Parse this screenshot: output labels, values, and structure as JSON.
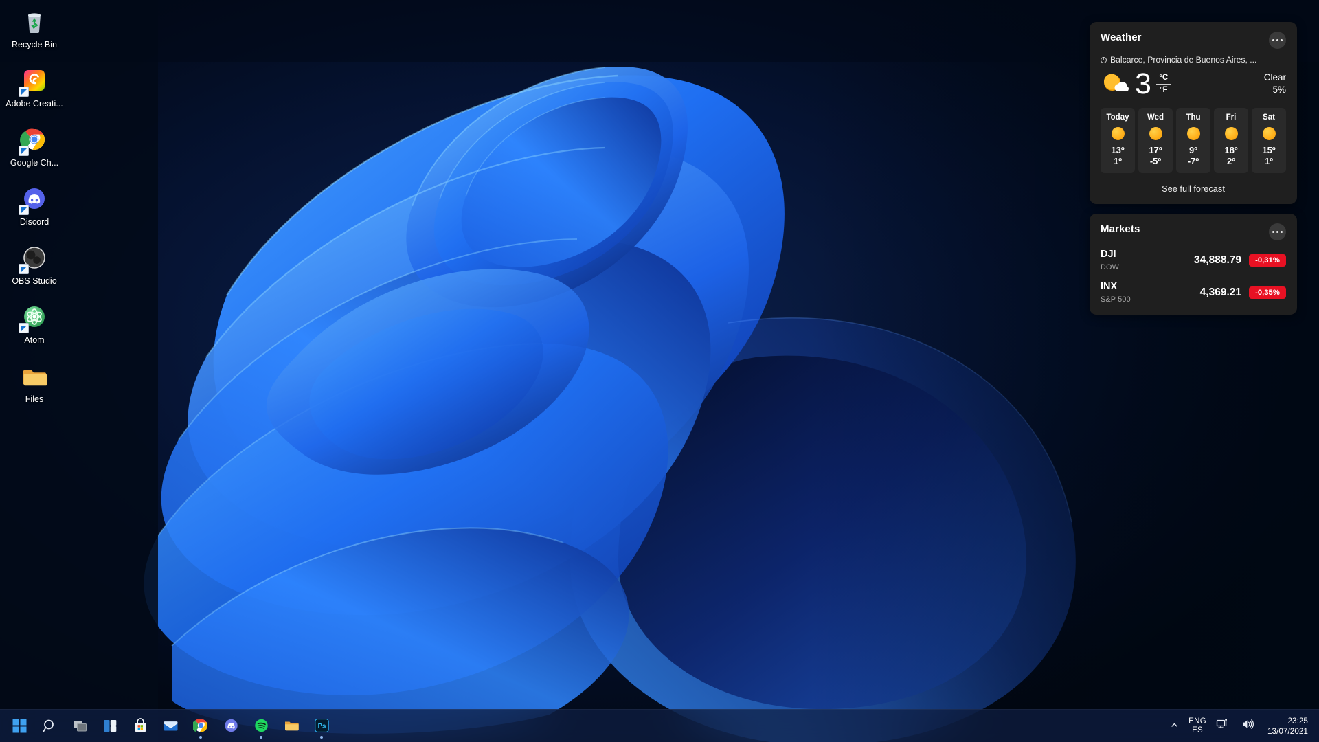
{
  "desktop": {
    "icons": [
      {
        "label": "Recycle Bin",
        "icon": "recycle-bin-icon",
        "shortcut": false
      },
      {
        "label": "Adobe Creati...",
        "icon": "adobe-creative-cloud-icon",
        "shortcut": true
      },
      {
        "label": "Google Ch...",
        "icon": "google-chrome-icon",
        "shortcut": true
      },
      {
        "label": "Discord",
        "icon": "discord-icon",
        "shortcut": true
      },
      {
        "label": "OBS Studio",
        "icon": "obs-studio-icon",
        "shortcut": true
      },
      {
        "label": "Atom",
        "icon": "atom-icon",
        "shortcut": true
      },
      {
        "label": "Files",
        "icon": "folder-icon",
        "shortcut": false
      }
    ]
  },
  "widgets": {
    "weather": {
      "title": "Weather",
      "more_label": "More options",
      "location": "Balcarce, Provincia de Buenos Aires, ...",
      "temperature": "3",
      "unit_primary": "ºC",
      "unit_secondary": "ºF",
      "condition": "Clear",
      "precipitation": "5%",
      "current_icon": "sun-behind-cloud-icon",
      "forecast": [
        {
          "day": "Today",
          "icon": "sunny-icon",
          "high": "13º",
          "low": "1º"
        },
        {
          "day": "Wed",
          "icon": "sunny-icon",
          "high": "17º",
          "low": "-5º"
        },
        {
          "day": "Thu",
          "icon": "sunny-icon",
          "high": "9º",
          "low": "-7º"
        },
        {
          "day": "Fri",
          "icon": "sunny-icon",
          "high": "18º",
          "low": "2º"
        },
        {
          "day": "Sat",
          "icon": "sunny-icon",
          "high": "15º",
          "low": "1º"
        }
      ],
      "see_full_forecast": "See full forecast"
    },
    "markets": {
      "title": "Markets",
      "more_label": "More options",
      "rows": [
        {
          "symbol": "DJI",
          "name": "DOW",
          "value": "34,888.79",
          "change": "-0,31%",
          "change_color": "#e81123"
        },
        {
          "symbol": "INX",
          "name": "S&P 500",
          "value": "4,369.21",
          "change": "-0,35%",
          "change_color": "#e81123"
        }
      ]
    }
  },
  "taskbar": {
    "items": [
      {
        "name": "start-button",
        "label": "Start"
      },
      {
        "name": "search-button",
        "label": "Search"
      },
      {
        "name": "task-view-button",
        "label": "Task View"
      },
      {
        "name": "widgets-button",
        "label": "Widgets"
      },
      {
        "name": "microsoft-store-button",
        "label": "Microsoft Store"
      },
      {
        "name": "mail-button",
        "label": "Mail"
      },
      {
        "name": "google-chrome-button",
        "label": "Google Chrome"
      },
      {
        "name": "discord-button",
        "label": "Discord"
      },
      {
        "name": "spotify-button",
        "label": "Spotify"
      },
      {
        "name": "file-explorer-button",
        "label": "File Explorer"
      },
      {
        "name": "photoshop-button",
        "label": "Adobe Photoshop"
      }
    ],
    "tray": {
      "show_hidden_label": "Show hidden icons",
      "language_primary": "ENG",
      "language_secondary": "ES",
      "network_label": "Network",
      "volume_label": "Volume",
      "time": "23:25",
      "date": "13/07/2021"
    }
  },
  "colors": {
    "accent": "#0078d4",
    "widget_card": "#1f1f1f",
    "negative": "#e81123",
    "taskbar": "#0f1f43"
  }
}
